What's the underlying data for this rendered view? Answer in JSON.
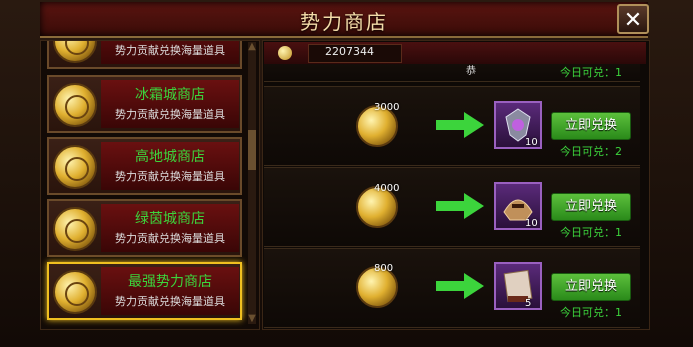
{
  "header": {
    "title": "势力商店",
    "close_glyph": "✕"
  },
  "sidebar": {
    "items": [
      {
        "name": "",
        "desc": "势力贡献兑换海量道具"
      },
      {
        "name": "冰霜城商店",
        "desc": "势力贡献兑换海量道具"
      },
      {
        "name": "高地城商店",
        "desc": "势力贡献兑换海量道具"
      },
      {
        "name": "绿茵城商店",
        "desc": "势力贡献兑换海量道具"
      },
      {
        "name": "最强势力商店",
        "desc": "势力贡献兑换海量道具",
        "active": true
      }
    ]
  },
  "balance": {
    "value": "2207344",
    "icon": "coin-icon"
  },
  "ticker": "恭",
  "top_partial_row": {
    "today": "今日可兑：1"
  },
  "rows": [
    {
      "cost": "3000",
      "count": "10",
      "button": "立即兑换",
      "today": "今日可兑：2",
      "icon": "crest-icon"
    },
    {
      "cost": "4000",
      "count": "10",
      "button": "立即兑换",
      "today": "今日可兑：1",
      "icon": "helmet-icon"
    },
    {
      "cost": "800",
      "count": "5",
      "button": "立即兑换",
      "today": "今日可兑：1",
      "icon": "scroll-icon"
    }
  ],
  "colors": {
    "accent_green": "#3cd43c",
    "title_gold": "#f3dba8",
    "panel_red": "#6a1010",
    "active_gold": "#f0c020"
  }
}
